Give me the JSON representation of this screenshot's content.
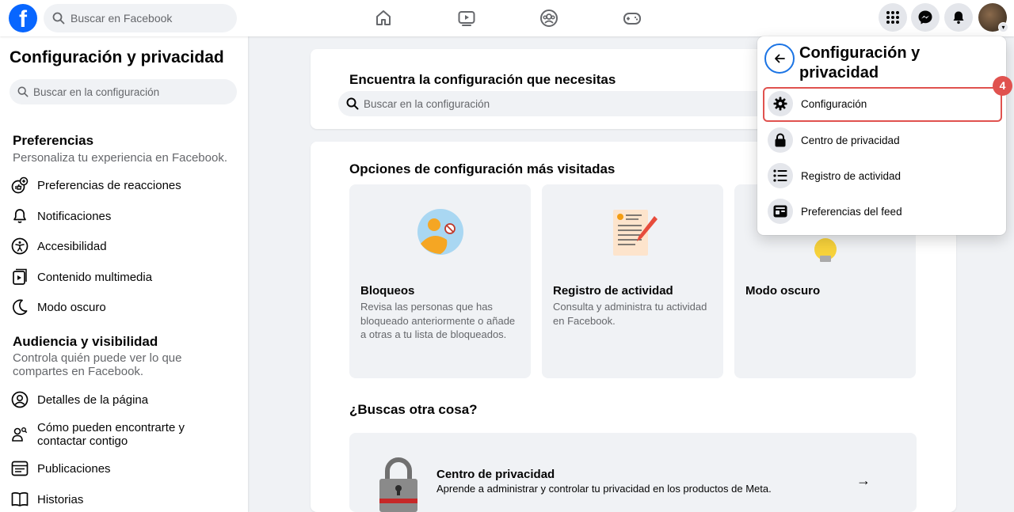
{
  "topbar": {
    "logo": "f",
    "search_placeholder": "Buscar en Facebook",
    "nav_icons": [
      "home-icon",
      "watch-icon",
      "groups-icon",
      "gaming-icon"
    ],
    "right_icons": [
      "menu-grid-icon",
      "messenger-icon",
      "bell-icon"
    ]
  },
  "sidebar": {
    "title": "Configuración y privacidad",
    "search_placeholder": "Buscar en la configuración",
    "sections": [
      {
        "title": "Preferencias",
        "description": "Personaliza tu experiencia en Facebook.",
        "items": [
          {
            "label": "Preferencias de reacciones",
            "icon": "reactions-icon"
          },
          {
            "label": "Notificaciones",
            "icon": "bell-icon"
          },
          {
            "label": "Accesibilidad",
            "icon": "accessibility-icon"
          },
          {
            "label": "Contenido multimedia",
            "icon": "media-icon"
          },
          {
            "label": "Modo oscuro",
            "icon": "moon-icon"
          }
        ]
      },
      {
        "title": "Audiencia y visibilidad",
        "description": "Controla quién puede ver lo que compartes en Facebook.",
        "items": [
          {
            "label": "Detalles de la página",
            "icon": "profile-icon"
          },
          {
            "label": "Cómo pueden encontrarte y contactar contigo",
            "icon": "find-people-icon"
          },
          {
            "label": "Publicaciones",
            "icon": "posts-icon"
          },
          {
            "label": "Historias",
            "icon": "stories-icon"
          }
        ]
      }
    ]
  },
  "main": {
    "find_title": "Encuentra la configuración que necesitas",
    "find_placeholder": "Buscar en la configuración",
    "visited_title": "Opciones de configuración más visitadas",
    "tiles": [
      {
        "title": "Bloqueos",
        "description": "Revisa las personas que has bloqueado anteriormente o añade a otras a tu lista de bloqueados."
      },
      {
        "title": "Registro de actividad",
        "description": "Consulta y administra tu actividad en Facebook."
      },
      {
        "title": "Modo oscuro",
        "description": ""
      }
    ],
    "other_title": "¿Buscas otra cosa?",
    "privacy_center": {
      "title": "Centro de privacidad",
      "description": "Aprende a administrar y controlar tu privacidad en los productos de Meta.",
      "arrow": "→"
    }
  },
  "panel": {
    "title": "Configuración y privacidad",
    "items": [
      {
        "label": "Configuración",
        "icon": "gear-icon"
      },
      {
        "label": "Centro de privacidad",
        "icon": "lock-icon"
      },
      {
        "label": "Registro de actividad",
        "icon": "list-icon"
      },
      {
        "label": "Preferencias del feed",
        "icon": "feed-icon"
      }
    ],
    "step_badge": "4"
  },
  "colors": {
    "brand": "#0866ff",
    "highlight": "#e0524f",
    "background": "#f0f2f5"
  }
}
